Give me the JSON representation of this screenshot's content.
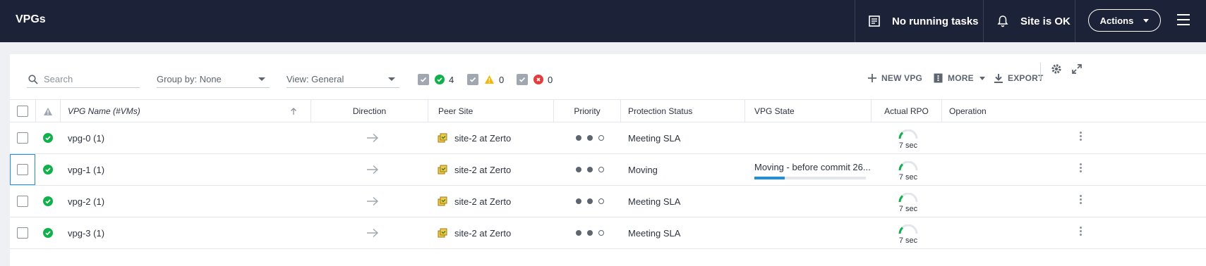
{
  "header": {
    "title": "VPGs",
    "tasks_label": "No running tasks",
    "site_label": "Site is OK",
    "actions_label": "Actions"
  },
  "toolbar": {
    "search_placeholder": "Search",
    "group_by": "Group by: None",
    "view": "View: General",
    "filters": [
      {
        "icon": "check-circle-icon",
        "count": "4",
        "color": "#10b14b"
      },
      {
        "icon": "warning-triangle-icon",
        "count": "0",
        "color": "#f2b705"
      },
      {
        "icon": "error-circle-icon",
        "count": "0",
        "color": "#e23c3c"
      }
    ],
    "new_vpg": "NEW VPG",
    "more": "MORE",
    "export": "EXPORT"
  },
  "table": {
    "columns": [
      "VPG Name (#VMs)",
      "Direction",
      "Peer Site",
      "Priority",
      "Protection Status",
      "VPG State",
      "Actual RPO",
      "Operation"
    ],
    "rows": [
      {
        "name": "vpg-0",
        "vms": "(1)",
        "peer": "site-2 at Zerto",
        "priority_filled": 2,
        "protection": "Meeting SLA",
        "state": "",
        "progress": null,
        "rpo": "7 sec"
      },
      {
        "name": "vpg-1",
        "vms": "(1)",
        "peer": "site-2 at Zerto",
        "priority_filled": 2,
        "protection": "Moving",
        "state": "Moving - before commit 26...",
        "progress": 0.27,
        "rpo": "7 sec"
      },
      {
        "name": "vpg-2",
        "vms": "(1)",
        "peer": "site-2 at Zerto",
        "priority_filled": 2,
        "protection": "Meeting SLA",
        "state": "",
        "progress": null,
        "rpo": "7 sec"
      },
      {
        "name": "vpg-3",
        "vms": "(1)",
        "peer": "site-2 at Zerto",
        "priority_filled": 2,
        "protection": "Meeting SLA",
        "state": "",
        "progress": null,
        "rpo": "7 sec"
      }
    ]
  },
  "colors": {
    "header_bg": "#1c2237",
    "ok": "#10b14b",
    "accent": "#1f8fe0",
    "site_icon": "#f2c94c"
  }
}
